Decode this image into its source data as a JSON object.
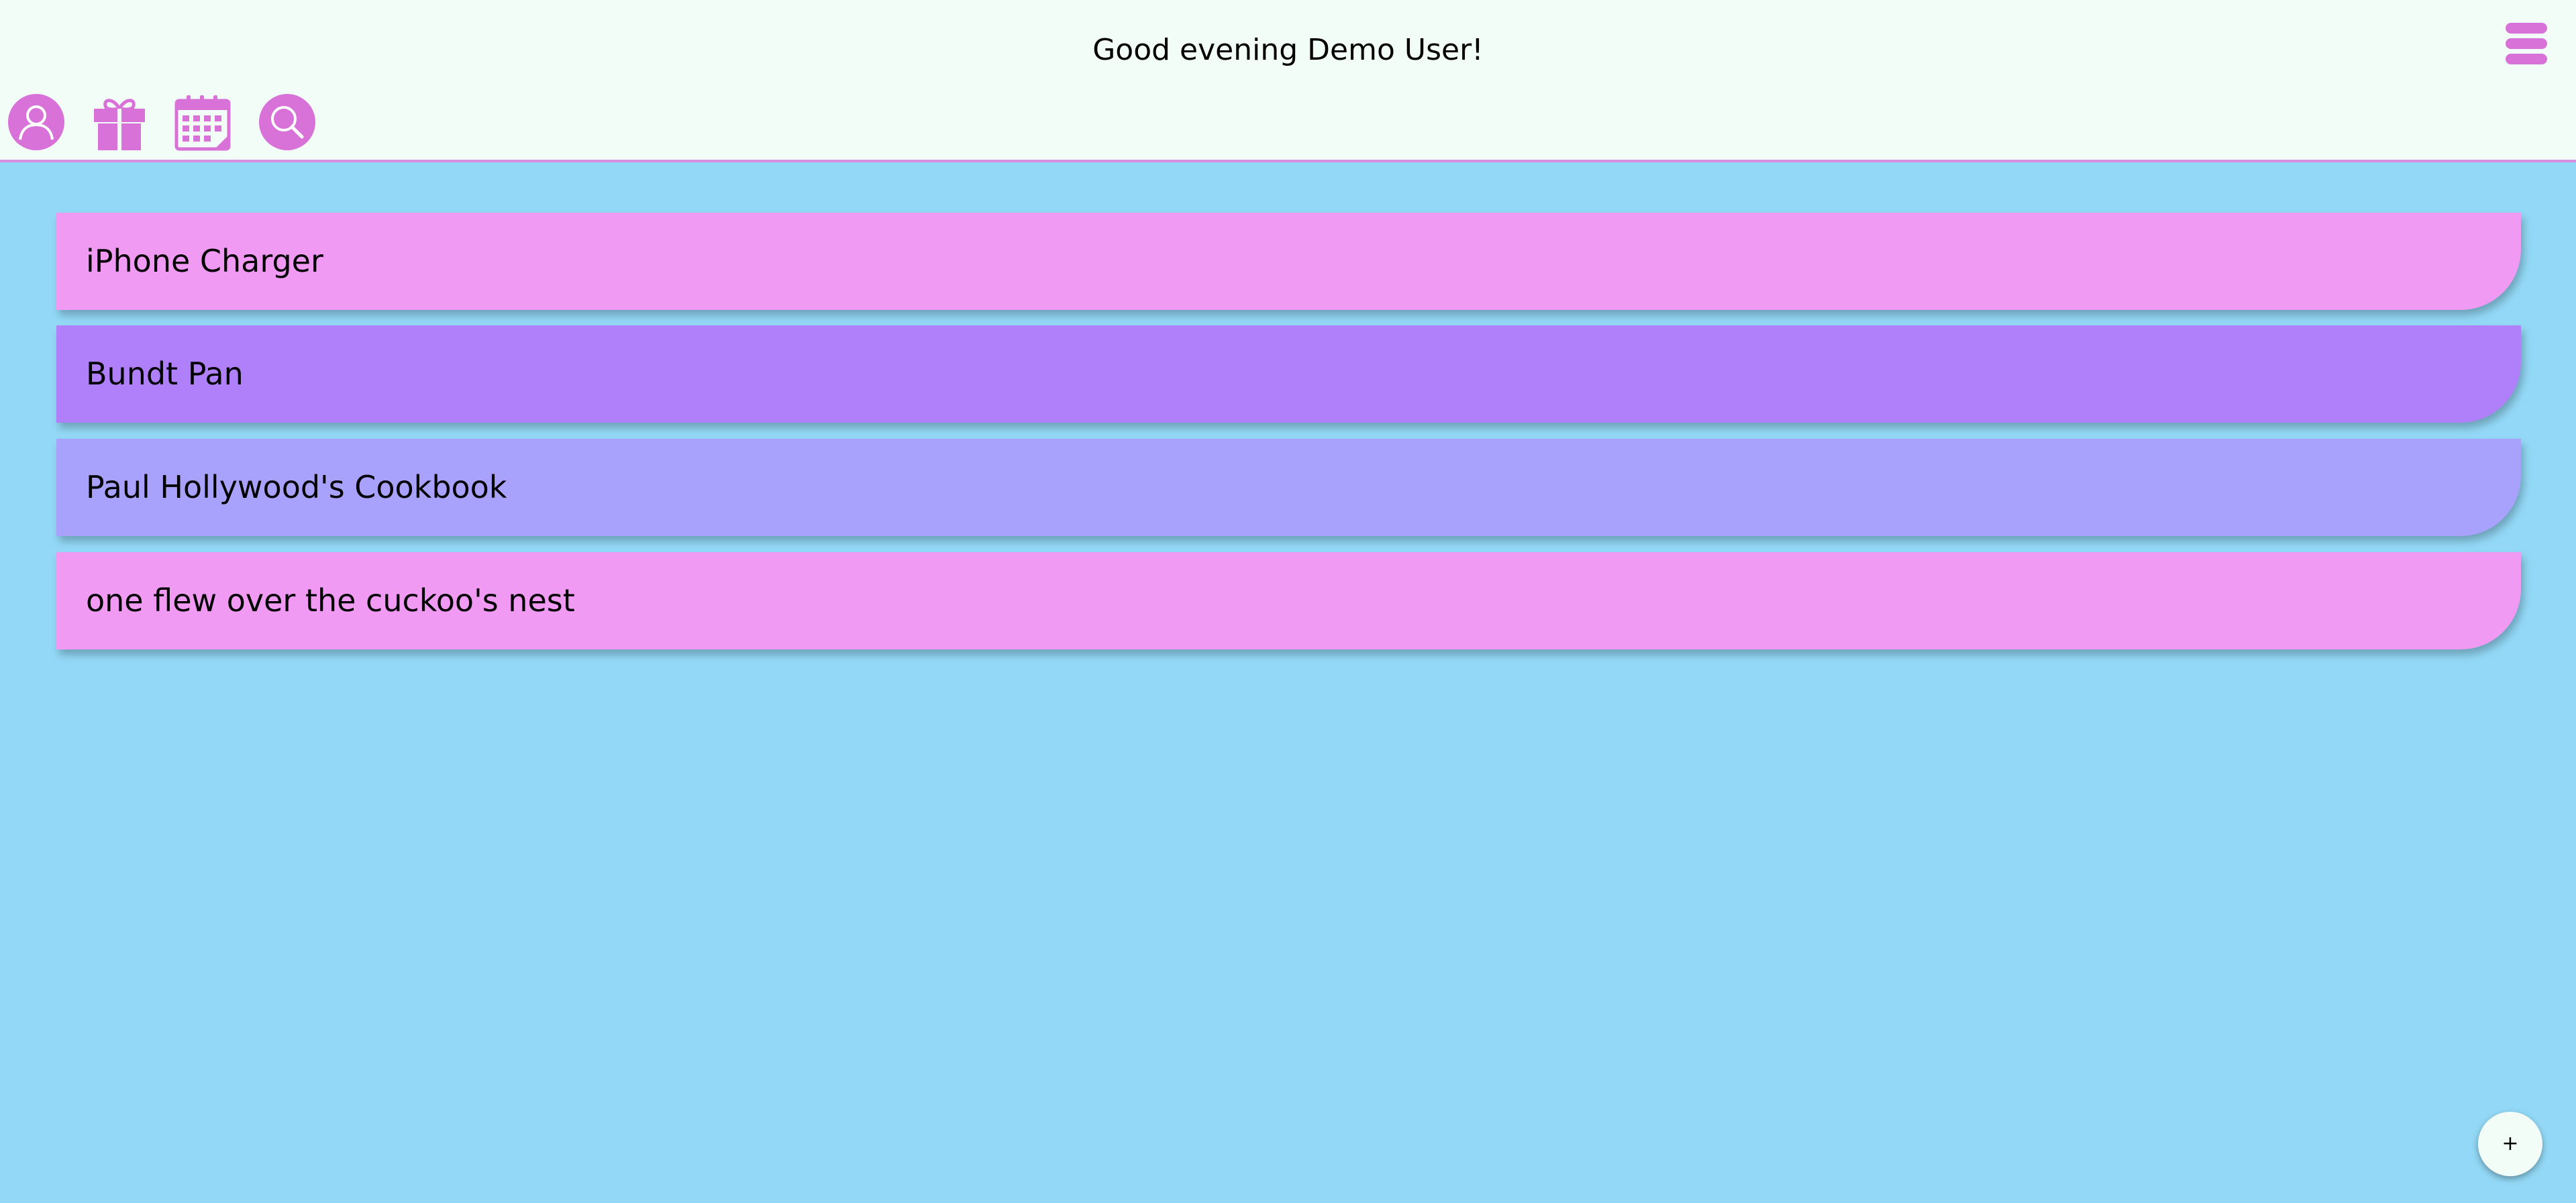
{
  "header": {
    "greeting": "Good evening Demo User!",
    "menu_icon": "hamburger-menu-icon",
    "nav_icons": [
      "user-profile-icon",
      "gift-icon",
      "calendar-icon",
      "search-icon"
    ]
  },
  "items": [
    {
      "label": "iPhone Charger",
      "color": "#f09af3"
    },
    {
      "label": "Bundt Pan",
      "color": "#b07ffa"
    },
    {
      "label": "Paul Hollywood's Cookbook",
      "color": "#a8a2fc"
    },
    {
      "label": "one flew over the cuckoo's nest",
      "color": "#f09af3"
    }
  ],
  "add_button": {
    "label": "+"
  },
  "colors": {
    "background": "#93d9f7",
    "header_background": "#f3fdf7",
    "accent": "#d871d8"
  }
}
